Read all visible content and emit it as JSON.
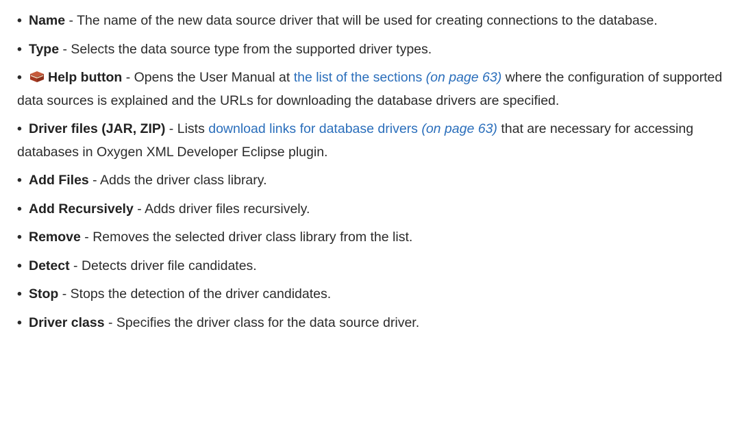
{
  "items": [
    {
      "term": "Name",
      "desc": " - The name of the new data source driver that will be used for creating connections to the database."
    },
    {
      "term": "Type",
      "desc": " - Selects the data source type from the supported driver types."
    },
    {
      "icon": "help-book-icon",
      "term": "Help button",
      "desc_before": " - Opens the User Manual at ",
      "link": "the list of the sections",
      "page_ref": "(on page 63)",
      "desc_after": " where the configuration of supported data sources is explained and the URLs for downloading the database drivers are specified."
    },
    {
      "term": "Driver files (JAR, ZIP)",
      "desc_before": " - Lists ",
      "link": "download links for database drivers",
      "page_ref": "(on page 63)",
      "desc_after": " that are necessary for accessing databases in Oxygen XML Developer Eclipse plugin."
    },
    {
      "term": "Add Files",
      "desc": " - Adds the driver class library."
    },
    {
      "term": "Add Recursively",
      "desc": " - Adds driver files recursively."
    },
    {
      "term": "Remove",
      "desc": " - Removes the selected driver class library from the list."
    },
    {
      "term": "Detect",
      "desc": " - Detects driver file candidates."
    },
    {
      "term": "Stop",
      "desc": " - Stops the detection of the driver candidates."
    },
    {
      "term": "Driver class",
      "desc": " - Specifies the driver class for the data source driver."
    }
  ],
  "colors": {
    "text": "#2b2b2b",
    "link": "#2a6ebb",
    "book_cover": "#b5452a",
    "book_pages": "#f2e6cf"
  }
}
